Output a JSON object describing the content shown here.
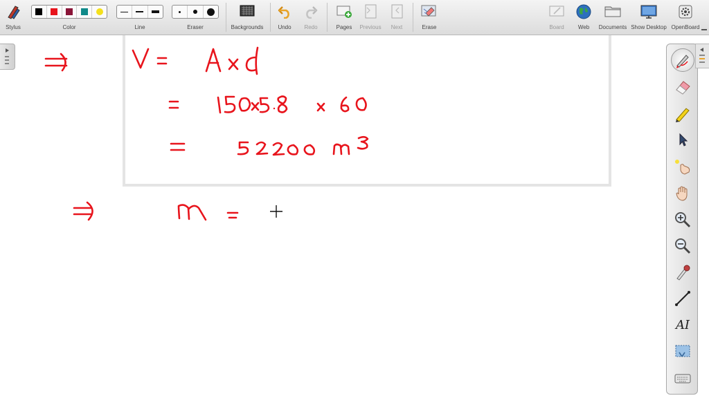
{
  "toolbar": {
    "stylus_label": "Stylus",
    "color_label": "Color",
    "line_label": "Line",
    "eraser_label": "Eraser",
    "backgrounds_label": "Backgrounds",
    "undo_label": "Undo",
    "redo_label": "Redo",
    "pages_label": "Pages",
    "previous_label": "Previous",
    "next_label": "Next",
    "erase_label": "Erase",
    "board_label": "Board",
    "web_label": "Web",
    "documents_label": "Documents",
    "show_desktop_label": "Show Desktop",
    "openboard_label": "OpenBoard",
    "colors": [
      "#000000",
      "#e8141c",
      "#8a1538",
      "#108a8a",
      "#f4e01c"
    ]
  },
  "palette": {
    "tools": [
      "pen-icon",
      "eraser-icon",
      "highlighter-icon",
      "selector-icon",
      "laser-pointer-icon",
      "hand-icon",
      "zoom-in-icon",
      "zoom-out-icon",
      "capture-icon",
      "line-icon",
      "text-icon",
      "screen-capture-icon",
      "keyboard-icon"
    ],
    "text_tool": "AI"
  },
  "ink_color": "#e8141c"
}
